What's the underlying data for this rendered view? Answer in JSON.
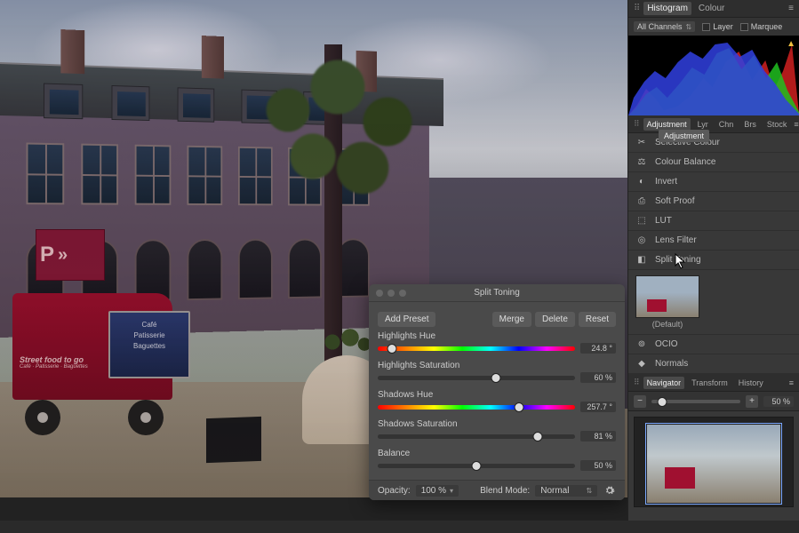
{
  "canvas": {
    "sign": {
      "letter": "P",
      "arrows": "»"
    },
    "truck": {
      "headline": "Street food to go",
      "subline": "Café · Patisserie · Baguettes",
      "menu": {
        "line1": "Café",
        "line2": "Patisserie",
        "line3": "Baguettes"
      }
    }
  },
  "splitToning": {
    "title": "Split Toning",
    "addPreset": "Add Preset",
    "merge": "Merge",
    "delete": "Delete",
    "reset": "Reset",
    "highlightsHueLabel": "Highlights Hue",
    "highlightsHueValue": "24.8 °",
    "highlightsHuePct": 7,
    "highlightsSatLabel": "Highlights Saturation",
    "highlightsSatValue": "60 %",
    "highlightsSatPct": 60,
    "shadowsHueLabel": "Shadows Hue",
    "shadowsHueValue": "257.7 °",
    "shadowsHuePct": 71.5,
    "shadowsSatLabel": "Shadows Saturation",
    "shadowsSatValue": "81 %",
    "shadowsSatPct": 81,
    "balanceLabel": "Balance",
    "balanceValue": "50 %",
    "balancePct": 50,
    "opacityLabel": "Opacity:",
    "opacityValue": "100 %",
    "blendModeLabel": "Blend Mode:",
    "blendModeValue": "Normal"
  },
  "sidebar": {
    "topTabs": {
      "histogram": "Histogram",
      "colour": "Colour"
    },
    "histCtrl": {
      "channels": "All Channels",
      "layer": "Layer",
      "marquee": "Marquee"
    },
    "adjTabs": {
      "adjustment": "Adjustment",
      "lyr": "Lyr",
      "chn": "Chn",
      "brs": "Brs",
      "stock": "Stock"
    },
    "tooltip": "Adjustment",
    "items": {
      "selectiveColour": "Selective Colour",
      "colourBalance": "Colour Balance",
      "invert": "Invert",
      "softProof": "Soft Proof",
      "lut": "LUT",
      "lensFilter": "Lens Filter",
      "splitToning": "Split Toning",
      "defaultPreset": "(Default)",
      "ocio": "OCIO",
      "normals": "Normals"
    },
    "navTabs": {
      "navigator": "Navigator",
      "transform": "Transform",
      "history": "History"
    },
    "zoom": {
      "value": "50 %",
      "pct": 12
    }
  }
}
